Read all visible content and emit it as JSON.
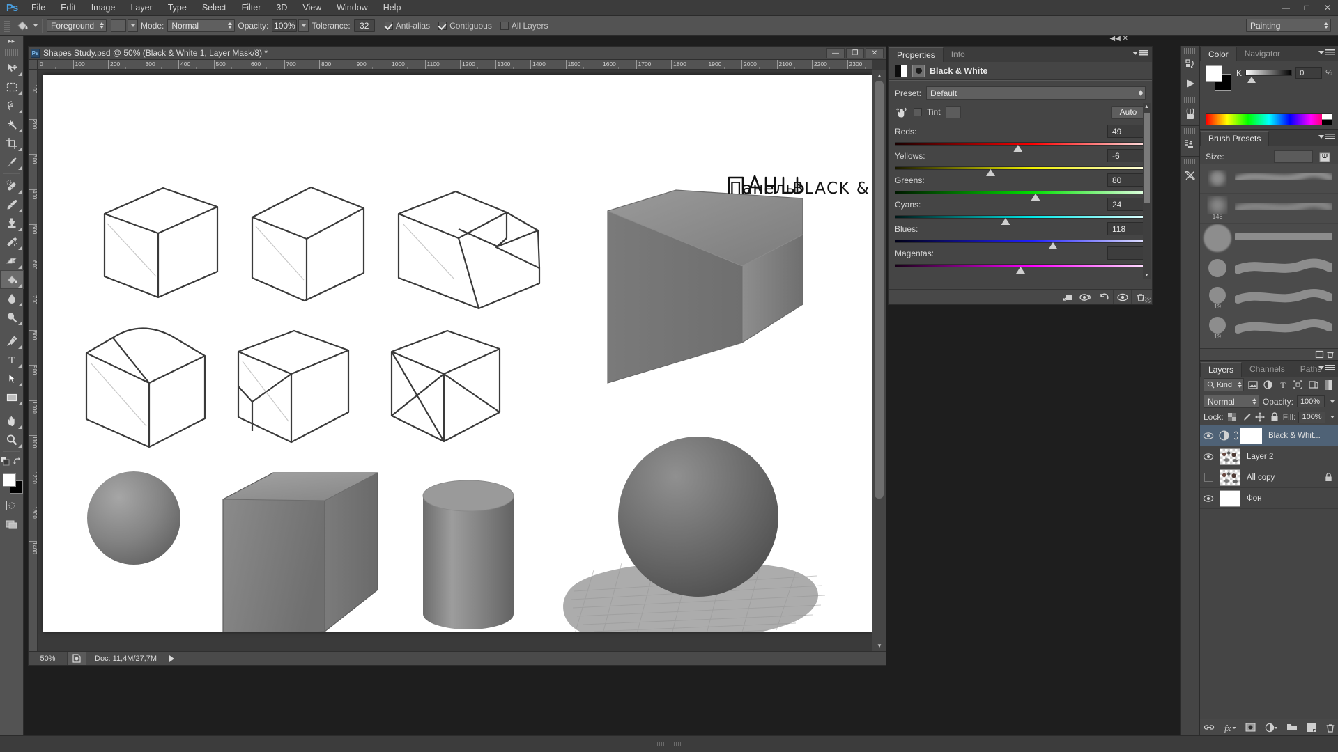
{
  "app": {
    "name": "Photoshop",
    "logo_text": "Ps",
    "menus": [
      "File",
      "Edit",
      "Image",
      "Layer",
      "Type",
      "Select",
      "Filter",
      "3D",
      "View",
      "Window",
      "Help"
    ],
    "window_controls": {
      "minimize": "—",
      "maximize": "□",
      "close": "✕"
    },
    "workspace": "Painting"
  },
  "options_bar": {
    "tool_icon": "paint-bucket-icon",
    "fill_source": "Foreground",
    "mode_label": "Mode:",
    "mode_value": "Normal",
    "opacity_label": "Opacity:",
    "opacity_value": "100%",
    "tolerance_label": "Tolerance:",
    "tolerance_value": "32",
    "anti_alias_label": "Anti-alias",
    "anti_alias_checked": true,
    "contiguous_label": "Contiguous",
    "contiguous_checked": true,
    "all_layers_label": "All Layers",
    "all_layers_checked": false
  },
  "toolbar": {
    "tools": [
      {
        "name": "move-tool",
        "sub": true
      },
      {
        "name": "rectangular-marquee-tool",
        "sub": true
      },
      {
        "name": "lasso-tool",
        "sub": true
      },
      {
        "name": "magic-wand-tool",
        "sub": true
      },
      {
        "name": "crop-tool",
        "sub": true
      },
      {
        "name": "eyedropper-tool",
        "sub": true
      },
      {
        "name": "spot-healing-brush-tool",
        "sub": true
      },
      {
        "name": "brush-tool",
        "sub": true
      },
      {
        "name": "clone-stamp-tool",
        "sub": true
      },
      {
        "name": "history-brush-tool",
        "sub": true
      },
      {
        "name": "eraser-tool",
        "sub": true
      },
      {
        "name": "paint-bucket-tool",
        "sub": true,
        "active": true
      },
      {
        "name": "blur-tool",
        "sub": true
      },
      {
        "name": "dodge-tool",
        "sub": true
      },
      {
        "name": "pen-tool",
        "sub": true
      },
      {
        "name": "type-tool",
        "sub": true
      },
      {
        "name": "path-selection-tool",
        "sub": true
      },
      {
        "name": "rectangle-tool",
        "sub": true
      },
      {
        "name": "hand-tool",
        "sub": true
      },
      {
        "name": "zoom-tool",
        "sub": true
      }
    ],
    "foreground_color": "#ffffff",
    "background_color": "#000000"
  },
  "document": {
    "title": "Shapes Study.psd @ 50% (Black & White 1, Layer Mask/8) *",
    "window_buttons": {
      "minimize": "—",
      "restore": "❐",
      "close": "✕"
    },
    "ruler_ticks": [
      "0",
      "100",
      "200",
      "300",
      "400",
      "500",
      "600",
      "700",
      "800",
      "900",
      "1000",
      "1100",
      "1200",
      "1300",
      "1400",
      "1500",
      "1600",
      "1700",
      "1800",
      "1900",
      "2000",
      "2100",
      "2200",
      "2300"
    ],
    "ruler_v_ticks": [
      "100",
      "200",
      "300",
      "400",
      "500",
      "600",
      "700",
      "800",
      "900",
      "1000",
      "1100",
      "1200",
      "1300",
      "1400"
    ],
    "annotation": "Панель   BLACK & WHITE   ⟶",
    "status": {
      "zoom": "50%",
      "doc_label": "Doc: 11,4M/27,7M",
      "preview_icon": "document-preview-icon",
      "expand_icon": "play-arrow-icon"
    }
  },
  "properties_panel": {
    "tabs": [
      {
        "label": "Properties",
        "active": true
      },
      {
        "label": "Info",
        "active": false
      }
    ],
    "adjustment_icon": "black-and-white-adjustment-icon",
    "mask_icon": "mask-thumbnail-icon",
    "title": "Black & White",
    "preset_label": "Preset:",
    "preset_value": "Default",
    "tint_label": "Tint",
    "tint_checked": false,
    "auto_label": "Auto",
    "sliders": [
      {
        "label": "Reds:",
        "value": "49",
        "pos": 49,
        "from": "#1a0000",
        "mid": "#ff0000",
        "to": "#ffdede"
      },
      {
        "label": "Yellows:",
        "value": "-6",
        "pos": 38,
        "from": "#181800",
        "mid": "#f0f000",
        "to": "#ffffe0"
      },
      {
        "label": "Greens:",
        "value": "80",
        "pos": 56,
        "from": "#001800",
        "mid": "#00e000",
        "to": "#e0ffe0"
      },
      {
        "label": "Cyans:",
        "value": "24",
        "pos": 44,
        "from": "#001818",
        "mid": "#00e8e8",
        "to": "#e0ffff"
      },
      {
        "label": "Blues:",
        "value": "118",
        "pos": 63,
        "from": "#000018",
        "mid": "#2020ff",
        "to": "#e0e0ff"
      },
      {
        "label": "Magentas:",
        "value": "",
        "pos": 50,
        "from": "#180018",
        "mid": "#ff00ff",
        "to": "#ffe0ff"
      }
    ],
    "footer_icons": [
      "clip-to-layer-icon",
      "toggle-layer-visibility-icon",
      "reset-icon",
      "preview-eye-icon",
      "delete-icon"
    ]
  },
  "color_panel": {
    "tabs": [
      {
        "label": "Color",
        "active": true
      },
      {
        "label": "Navigator",
        "active": false
      }
    ],
    "channel_label": "K",
    "channel_value": "0",
    "percent_label": "%",
    "foreground": "#ffffff",
    "background": "#000000"
  },
  "brush_panel": {
    "tab": "Brush Presets",
    "size_label": "Size:",
    "size_value": "",
    "folder_icon": "brush-preset-folder-icon",
    "brushes": [
      {
        "size": "",
        "kind": "soft-round"
      },
      {
        "size": "145",
        "kind": "soft-round"
      },
      {
        "size": "",
        "kind": "soft-round-large"
      },
      {
        "size": "",
        "kind": "hard-round-large"
      },
      {
        "size": "19",
        "kind": "hard-round"
      },
      {
        "size": "19",
        "kind": "hard-round"
      }
    ],
    "footer_icons": [
      "new-brush-icon",
      "delete-brush-icon"
    ]
  },
  "layers_panel": {
    "tabs": [
      {
        "label": "Layers",
        "active": true
      },
      {
        "label": "Channels",
        "active": false
      },
      {
        "label": "Paths",
        "active": false
      }
    ],
    "filter_label": "Kind",
    "filter_icons": [
      "filter-pixel-icon",
      "filter-adjustment-icon",
      "filter-type-icon",
      "filter-shape-icon",
      "filter-smart-object-icon",
      "filter-toggle-icon"
    ],
    "blend_mode": "Normal",
    "opacity_label": "Opacity:",
    "opacity_value": "100%",
    "lock_label": "Lock:",
    "lock_icons": [
      "lock-transparency-icon",
      "lock-image-icon",
      "lock-position-icon",
      "lock-all-icon"
    ],
    "fill_label": "Fill:",
    "fill_value": "100%",
    "layers": [
      {
        "name": "Black & Whit...",
        "visible": true,
        "selected": true,
        "type": "adjustment",
        "locked": false,
        "linked": true
      },
      {
        "name": "Layer 2",
        "visible": true,
        "selected": false,
        "type": "pixel",
        "locked": false,
        "linked": false
      },
      {
        "name": "All copy",
        "visible": false,
        "selected": false,
        "type": "pixel",
        "locked": true,
        "linked": false
      },
      {
        "name": "Фон",
        "visible": true,
        "selected": false,
        "type": "background",
        "locked": false,
        "linked": false
      }
    ],
    "footer_icons": [
      "link-layers-icon",
      "layer-styles-fx-icon",
      "add-layer-mask-icon",
      "new-adjustment-layer-icon",
      "new-group-icon",
      "new-layer-icon",
      "delete-layer-icon"
    ]
  },
  "rail_icons": [
    "history-icon",
    "actions-play-icon",
    "brush-icon",
    "clone-source-icon",
    "tool-presets-icon"
  ],
  "colors": {
    "panel_bg": "#454545",
    "chrome_bg": "#3c3c3c",
    "options_bg": "#535353",
    "selection_blue": "#4f6276",
    "accent_blue": "#4a9fe0"
  }
}
